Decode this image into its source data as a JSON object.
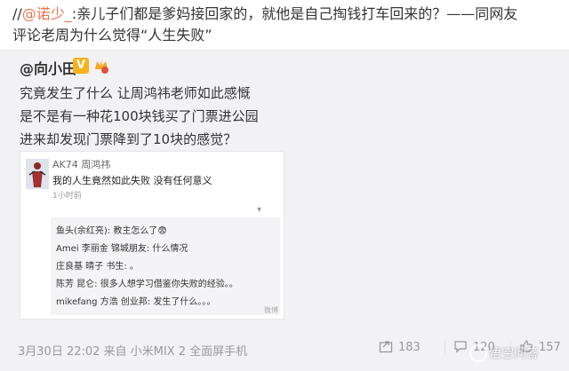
{
  "repost": {
    "prefix": "//",
    "mention": "@诺少_",
    "text_line1": ":亲儿子们都是爹妈接回家的，就他是自己掏钱打车回来的？——同网友",
    "text_line2": "评论老周为什么觉得“人生失败”"
  },
  "post": {
    "author": "@向小田",
    "verified_icon": "verified-v-icon",
    "vip_icon": "vip-badge-icon",
    "lines": [
      "究竟发生了什么 让周鸿祎老师如此感慨",
      "是不是有一种花100块钱买了门票进公园",
      "进来却发现门票降到了10块的感觉？"
    ]
  },
  "screenshot": {
    "name": "AK74 周鸿祎",
    "text": "我的人生竟然如此失败 没有任何意义",
    "time": "1小时前",
    "comments": [
      "鱼头(余红亮): 教主怎么了😨",
      "Amei 李丽金 锦城朋友: 什么情况",
      "庄良基 晴子 书生: 。",
      "陈芳 昆仑: 很多人想学习借鉴你失败的经验。。",
      "mikefang 方浩 创业邦: 发生了什么。。。"
    ],
    "watermark": "微博"
  },
  "footer": {
    "time": "3月30日 22:02 来自 小米MIX 2 全面屏手机",
    "repost_count": "183",
    "comment_count": "120",
    "like_count": "157"
  },
  "corner_watermark": "悟空问答",
  "colors": {
    "mention": "#eb7350",
    "meta": "#999999",
    "badge": "#f6b21b"
  }
}
